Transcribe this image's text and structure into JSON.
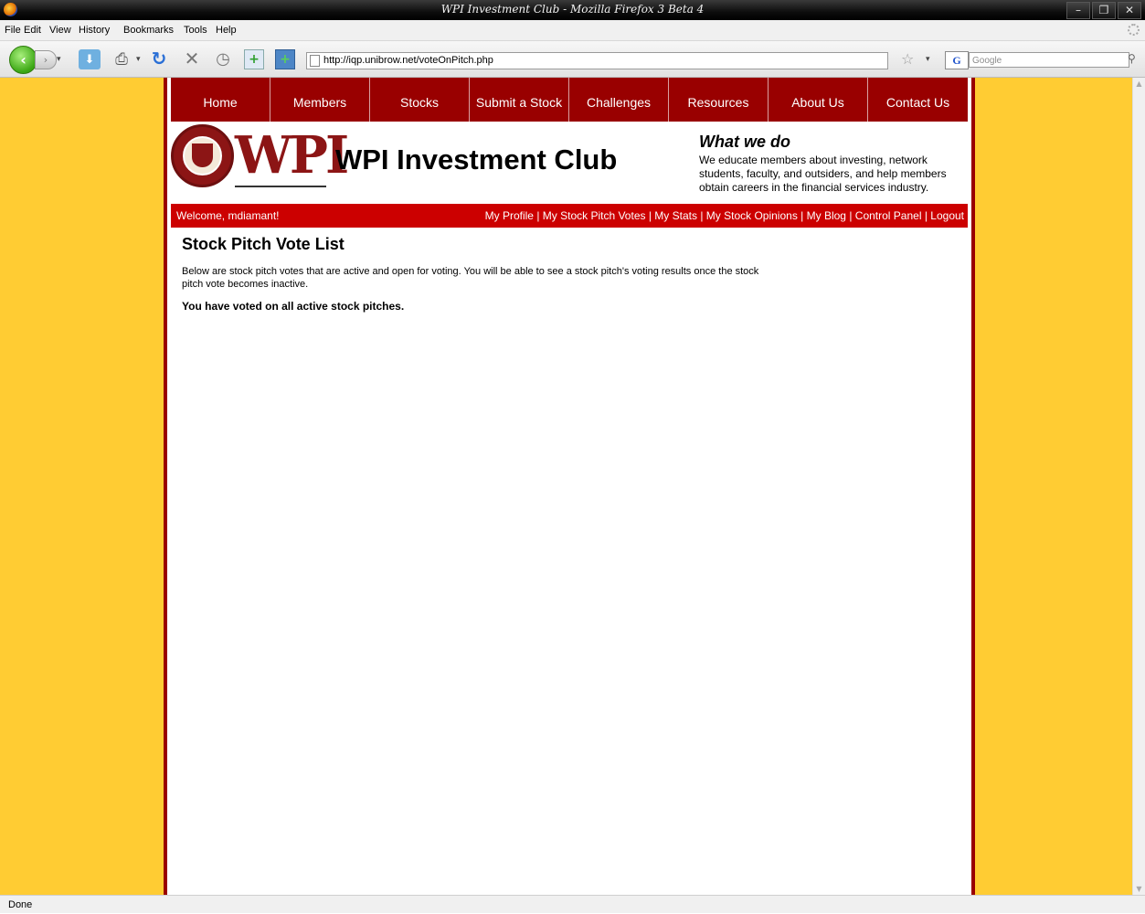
{
  "window": {
    "title": "WPI Investment Club - Mozilla Firefox 3 Beta 4",
    "controls": {
      "minimize": "–",
      "restore": "❐",
      "close": "✕"
    }
  },
  "menu": [
    "File",
    "Edit",
    "View",
    "History",
    "Bookmarks",
    "Tools",
    "Help"
  ],
  "toolbar": {
    "url": "http://iqp.unibrow.net/voteOnPitch.php",
    "search_placeholder": "Google",
    "search_engine_label": "G"
  },
  "site": {
    "nav": [
      "Home",
      "Members",
      "Stocks",
      "Submit a Stock",
      "Challenges",
      "Resources",
      "About Us",
      "Contact Us"
    ],
    "logo_text": "WPI",
    "title": "WPI Investment Club",
    "what_we_do": {
      "heading": "What we do",
      "text": "We educate members about investing, network students, faculty, and outsiders, and help members obtain careers in the financial services industry."
    },
    "welcome": "Welcome, mdiamant!",
    "user_links": [
      "My Profile",
      "My Stock Pitch Votes",
      "My Stats",
      "My Stock Opinions",
      "My Blog",
      "Control Panel",
      "Logout"
    ],
    "user_links_separator": " | "
  },
  "content": {
    "heading": "Stock Pitch Vote List",
    "description": "Below are stock pitch votes that are active and open for voting. You will be able to see a stock pitch's voting results once the stock pitch vote becomes inactive.",
    "notice": "You have voted on all active stock pitches."
  },
  "status": "Done",
  "colors": {
    "page_background": "#ffcc33",
    "nav_background": "#990000",
    "userbar_background": "#cc0000",
    "brand": "#8c1515"
  },
  "icons": [
    "back-arrow-icon",
    "forward-arrow-icon",
    "download-icon",
    "print-icon",
    "reload-icon",
    "stop-icon",
    "history-icon",
    "new-tab-icon",
    "new-window-icon",
    "page-icon",
    "bookmark-star-icon",
    "search-icon"
  ]
}
